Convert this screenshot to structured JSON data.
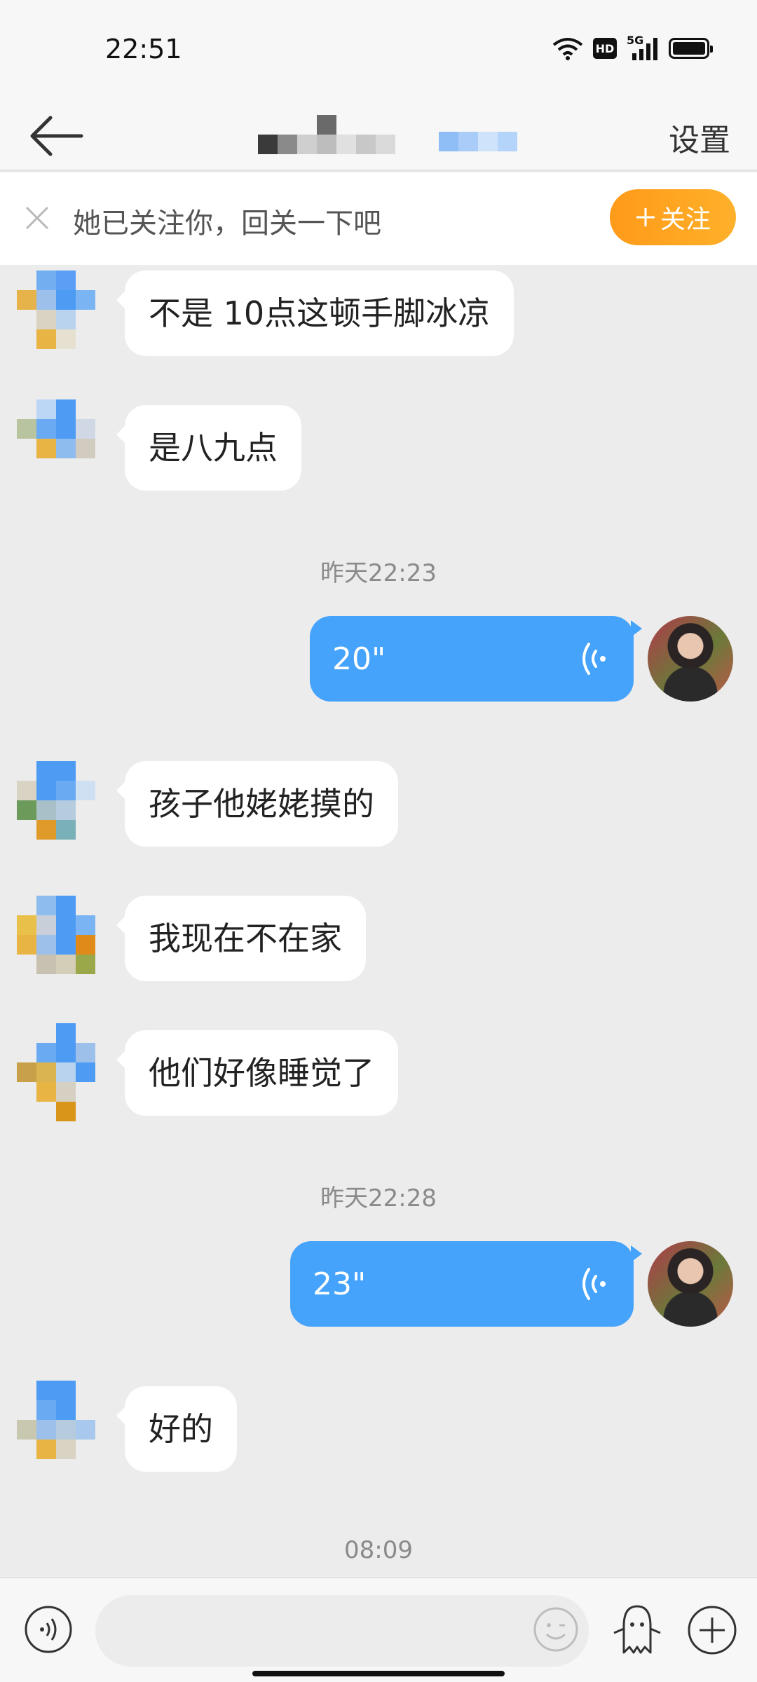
{
  "status_bar": {
    "time": "22:51",
    "icons": [
      "wifi-icon",
      "hd-icon",
      "signal-5g-icon",
      "battery-icon"
    ],
    "network_label": "5G",
    "hd_label": "HD"
  },
  "nav": {
    "settings_label": "设置",
    "back_icon": "arrow-left-icon"
  },
  "follow_banner": {
    "text": "她已关注你，回关一下吧",
    "button_label": "关注",
    "button_icon": "plus-icon",
    "colors": {
      "button": "#ffa11f"
    }
  },
  "messages": [
    {
      "type": "text",
      "side": "left",
      "text": "不是 10点这顿手脚冰凉"
    },
    {
      "type": "text",
      "side": "left",
      "text": "是八九点"
    },
    {
      "type": "timestamp",
      "text": "昨天22:23"
    },
    {
      "type": "voice",
      "side": "right",
      "duration": "20\""
    },
    {
      "type": "text",
      "side": "left",
      "text": "孩子他姥姥摸的"
    },
    {
      "type": "text",
      "side": "left",
      "text": "我现在不在家"
    },
    {
      "type": "text",
      "side": "left",
      "text": "他们好像睡觉了"
    },
    {
      "type": "timestamp",
      "text": "昨天22:28"
    },
    {
      "type": "voice",
      "side": "right",
      "duration": "23\""
    },
    {
      "type": "text",
      "side": "left",
      "text": "好的"
    },
    {
      "type": "timestamp",
      "text": "08:09"
    }
  ],
  "input_bar": {
    "placeholder": "",
    "icons": [
      "voice-input-icon",
      "emoji-icon",
      "sticker-icon",
      "plus-icon"
    ]
  },
  "colors": {
    "voice_bubble": "#45a3fb",
    "chat_background": "#ececec",
    "incoming_bubble": "#ffffff"
  }
}
